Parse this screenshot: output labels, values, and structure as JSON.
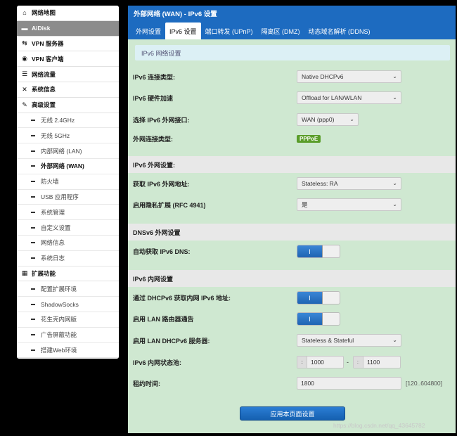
{
  "sidebar": {
    "items": [
      {
        "label": "网络地图",
        "icon": "home-icon",
        "glyph": "⌂",
        "type": "main",
        "active": false
      },
      {
        "label": "AiDisk",
        "icon": "disk-icon",
        "glyph": "▬",
        "type": "main",
        "active": true
      },
      {
        "label": "VPN 服务器",
        "icon": "vpn-server-icon",
        "glyph": "⇆",
        "type": "main",
        "active": false
      },
      {
        "label": "VPN 客户端",
        "icon": "globe-icon",
        "glyph": "◉",
        "type": "main",
        "active": false
      },
      {
        "label": "网络流量",
        "icon": "list-icon",
        "glyph": "☰",
        "type": "main",
        "active": false
      },
      {
        "label": "系统信息",
        "icon": "shuffle-icon",
        "glyph": "✕",
        "type": "main",
        "active": false
      },
      {
        "label": "高级设置",
        "icon": "wrench-icon",
        "glyph": "✎",
        "type": "main",
        "active": false
      },
      {
        "label": "无线 2.4GHz",
        "type": "sub"
      },
      {
        "label": "无线 5GHz",
        "type": "sub"
      },
      {
        "label": "内部网络 (LAN)",
        "type": "sub"
      },
      {
        "label": "外部网络 (WAN)",
        "type": "sub",
        "current": true
      },
      {
        "label": "防火墙",
        "type": "sub"
      },
      {
        "label": "USB 应用程序",
        "type": "sub"
      },
      {
        "label": "系统管理",
        "type": "sub"
      },
      {
        "label": "自定义设置",
        "type": "sub"
      },
      {
        "label": "网络信息",
        "type": "sub"
      },
      {
        "label": "系统日志",
        "type": "sub"
      },
      {
        "label": "扩展功能",
        "icon": "grid-icon",
        "glyph": "▦",
        "type": "main",
        "active": false
      },
      {
        "label": "配置扩展环境",
        "type": "sub"
      },
      {
        "label": "ShadowSocks",
        "type": "sub"
      },
      {
        "label": "花生壳内网版",
        "type": "sub"
      },
      {
        "label": "广告屏蔽功能",
        "type": "sub"
      },
      {
        "label": "搭建Web环境",
        "type": "sub"
      }
    ]
  },
  "main": {
    "title": "外部网络 (WAN) - IPv6 设置",
    "tabs": [
      "外网设置",
      "IPv6 设置",
      "端口转发 (UPnP)",
      "隔离区 (DMZ)",
      "动态域名解析 (DDNS)"
    ],
    "active_tab": 1,
    "info": "IPv6 网络设置",
    "fields": {
      "conn_type": {
        "label": "IPv6 连接类型:",
        "value": "Native DHCPv6"
      },
      "hw_accel": {
        "label": "IPv6 硬件加速",
        "value": "Offload for LAN/WLAN"
      },
      "wan_if": {
        "label": "选择 IPv6 外网接口:",
        "value": "WAN (ppp0)"
      },
      "ext_type": {
        "label": "外网连接类型:",
        "value": "PPPoE"
      },
      "sec_wan": "IPv6 外网设置:",
      "get_addr": {
        "label": "获取 IPv6 外网地址:",
        "value": "Stateless: RA"
      },
      "privacy": {
        "label": "启用隐私扩展 (RFC 4941)",
        "value": "是"
      },
      "sec_dns": "DNSv6 外网设置",
      "auto_dns": {
        "label": "自动获取 IPv6 DNS:",
        "toggle": "I"
      },
      "sec_lan": "IPv6 内网设置",
      "dhcp_addr": {
        "label": "通过 DHCPv6 获取内网 IPv6 地址:",
        "toggle": "I"
      },
      "lan_ra": {
        "label": "启用 LAN 路由器通告",
        "toggle": "I"
      },
      "lan_dhcp": {
        "label": "启用 LAN DHCPv6 服务器:",
        "value": "Stateless & Stateful"
      },
      "pool": {
        "label": "IPv6 内网状态池:",
        "start": "1000",
        "sep": "-",
        "end": "1100",
        "prefix": "::"
      },
      "lease": {
        "label": "租约时间:",
        "value": "1800",
        "hint": "[120..604800]"
      }
    },
    "apply_label": "应用本页面设置"
  },
  "watermark": "https://blog.csdn.net/qq_43645782",
  "colors": {
    "accent": "#1d6bc0",
    "panel": "#cfe8d1",
    "badge": "#5a9d2a"
  }
}
